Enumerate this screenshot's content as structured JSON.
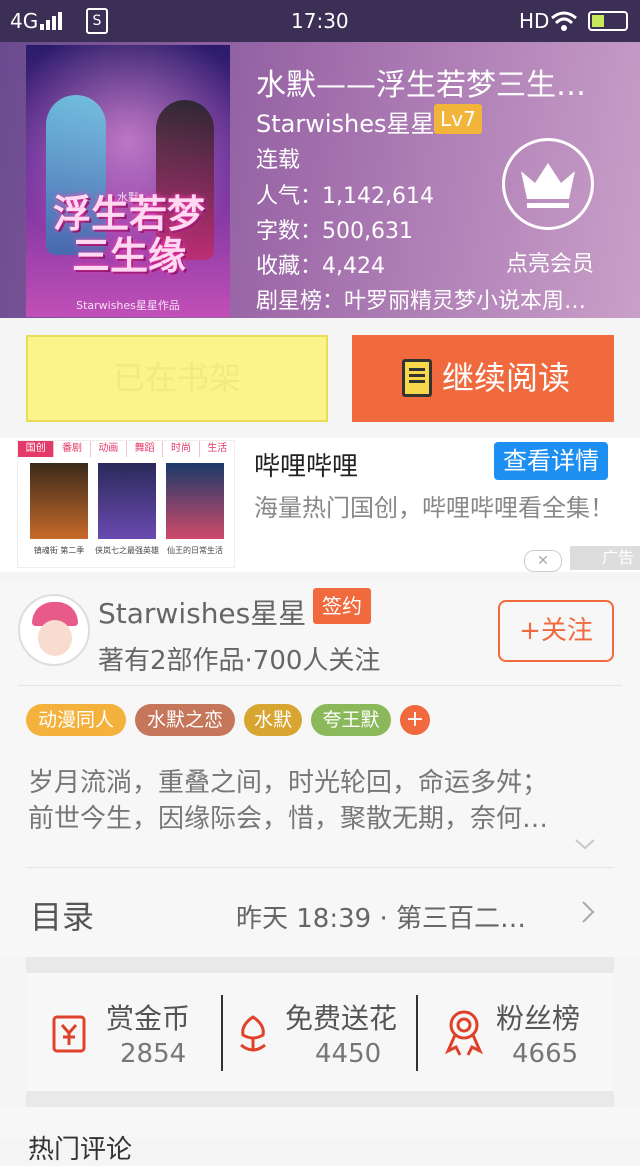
{
  "status_bar": {
    "network": "4G",
    "time": "17:30",
    "hd": "HD"
  },
  "book": {
    "title": "水默——浮生若梦三生…",
    "author": "Starwishes星星",
    "level": "Lv7",
    "status": "连载",
    "popularity_label": "人气：",
    "popularity": "1,142,614",
    "words_label": "字数：",
    "words": "500,631",
    "favorites_label": "收藏：",
    "favorites": "4,424",
    "rank_label": "剧星榜：",
    "rank": "叶罗丽精灵梦小说本周…",
    "cover": {
      "title_line1": "浮生若梦",
      "title_line2": "三生缘",
      "small": "水默",
      "credit": "Starwishes星星作品"
    },
    "vip_label": "点亮会员"
  },
  "actions": {
    "shelf": "已在书架",
    "read": "继续阅读"
  },
  "ad": {
    "tabs": [
      "国创",
      "番剧",
      "动画",
      "舞蹈",
      "时尚",
      "生活"
    ],
    "posters": [
      "镇魂街 第二季",
      "侠岚七之最强英雄",
      "仙王的日常生活"
    ],
    "title": "哔哩哔哩",
    "detail": "查看详情",
    "desc": "海量热门国创，哔哩哔哩看全集！",
    "tag": "广告",
    "close": "✕"
  },
  "author": {
    "name": "Starwishes星星",
    "sign": "签约",
    "stats": "著有2部作品·700人关注",
    "follow": "+关注"
  },
  "tags": [
    "动漫同人",
    "水默之恋",
    "水默",
    "夸王默"
  ],
  "tag_colors": [
    "#f4b13c",
    "#c5765b",
    "#d8a530",
    "#8ab85a"
  ],
  "intro": "岁月流淌，重叠之间，时光轮回，命运多舛；\n前世今生，因缘际会，惜，聚散无期，奈何…",
  "toc": {
    "title": "目录",
    "latest": "昨天 18:39 · 第三百二…"
  },
  "stats": [
    {
      "label": "赏金币",
      "value": "2854",
      "icon": "coin-envelope-icon"
    },
    {
      "label": "免费送花",
      "value": "4450",
      "icon": "flower-icon"
    },
    {
      "label": "粉丝榜",
      "value": "4665",
      "icon": "medal-icon"
    }
  ],
  "bottom": "热门评论"
}
